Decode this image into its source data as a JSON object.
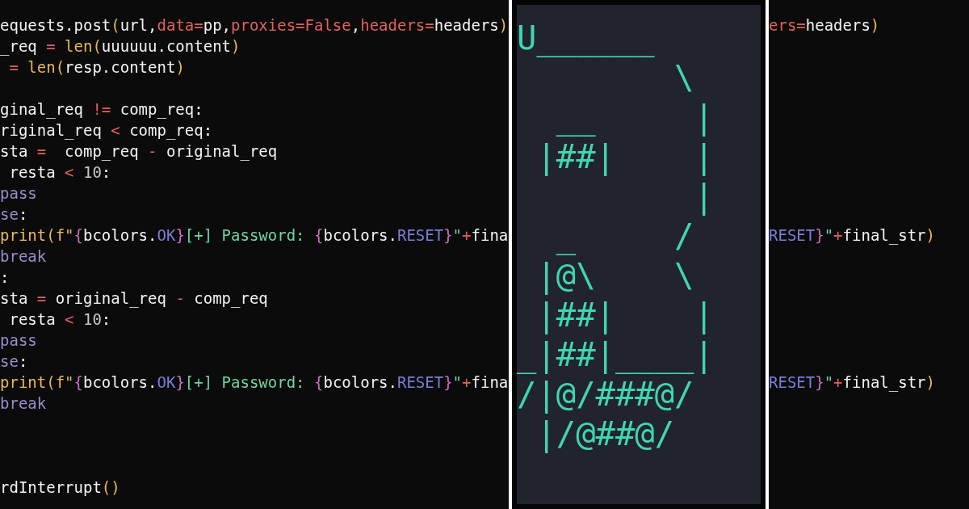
{
  "panels": [
    {
      "kind": "code",
      "lines": [
        {
          "tokens": [
            {
              "text": "equests.post",
              "kind": "plain"
            },
            {
              "text": "(",
              "kind": "call"
            },
            {
              "text": "url,",
              "kind": "plain"
            },
            {
              "text": "data=",
              "kind": "operator"
            },
            {
              "text": "pp,",
              "kind": "plain"
            },
            {
              "text": "proxies=False",
              "kind": "operator"
            },
            {
              "text": ",",
              "kind": "plain"
            },
            {
              "text": "headers=",
              "kind": "operator"
            },
            {
              "text": "headers",
              "kind": "plain"
            },
            {
              "text": ")",
              "kind": "call"
            }
          ]
        },
        {
          "tokens": [
            {
              "text": "_req ",
              "kind": "plain"
            },
            {
              "text": "=",
              "kind": "operator"
            },
            {
              "text": " len(",
              "kind": "call"
            },
            {
              "text": "uuuuuu.content",
              "kind": "plain"
            },
            {
              "text": ")",
              "kind": "call"
            }
          ]
        },
        {
          "tokens": [
            {
              "text": " =",
              "kind": "operator"
            },
            {
              "text": " len(",
              "kind": "call"
            },
            {
              "text": "resp.content",
              "kind": "plain"
            },
            {
              "text": ")",
              "kind": "call"
            }
          ]
        },
        {
          "kind": "blank"
        },
        {
          "tokens": [
            {
              "text": "ginal_req ",
              "kind": "plain"
            },
            {
              "text": "!=",
              "kind": "operator"
            },
            {
              "text": " comp_req:",
              "kind": "plain"
            }
          ]
        },
        {
          "tokens": [
            {
              "text": "riginal_req ",
              "kind": "plain"
            },
            {
              "text": "<",
              "kind": "operator"
            },
            {
              "text": " comp_req:",
              "kind": "plain"
            }
          ]
        },
        {
          "tokens": [
            {
              "text": "sta ",
              "kind": "plain"
            },
            {
              "text": "=",
              "kind": "operator"
            },
            {
              "text": "  comp_req ",
              "kind": "plain"
            },
            {
              "text": "-",
              "kind": "operator"
            },
            {
              "text": " original_req",
              "kind": "plain"
            }
          ]
        },
        {
          "tokens": [
            {
              "text": " resta ",
              "kind": "plain"
            },
            {
              "text": "<",
              "kind": "operator"
            },
            {
              "text": " 10",
              "kind": "number"
            },
            {
              "text": ":",
              "kind": "plain"
            }
          ]
        },
        {
          "tokens": [
            {
              "text": "pass",
              "kind": "keyword"
            }
          ]
        },
        {
          "tokens": [
            {
              "text": "se",
              "kind": "keyword"
            },
            {
              "text": ":",
              "kind": "plain"
            }
          ]
        },
        {
          "tokens": [
            {
              "text": "print(f\"",
              "kind": "call"
            },
            {
              "text": "{",
              "kind": "brace"
            },
            {
              "text": "bcolors.",
              "kind": "plain"
            },
            {
              "text": "OK",
              "kind": "member"
            },
            {
              "text": "}",
              "kind": "brace"
            },
            {
              "text": "[+] Password: ",
              "kind": "string"
            },
            {
              "text": "{",
              "kind": "brace"
            },
            {
              "text": "bcolors.",
              "kind": "plain"
            },
            {
              "text": "RESET",
              "kind": "member"
            },
            {
              "text": "}",
              "kind": "brace"
            },
            {
              "text": "\"",
              "kind": "string"
            },
            {
              "text": "+",
              "kind": "operator"
            },
            {
              "text": "fina",
              "kind": "plain"
            }
          ]
        },
        {
          "tokens": [
            {
              "text": "break",
              "kind": "keyword"
            }
          ]
        },
        {
          "tokens": [
            {
              "text": ":",
              "kind": "plain"
            }
          ]
        },
        {
          "tokens": [
            {
              "text": "sta ",
              "kind": "plain"
            },
            {
              "text": "=",
              "kind": "operator"
            },
            {
              "text": " original_req ",
              "kind": "plain"
            },
            {
              "text": "-",
              "kind": "operator"
            },
            {
              "text": " comp_req",
              "kind": "plain"
            }
          ]
        },
        {
          "tokens": [
            {
              "text": " resta ",
              "kind": "plain"
            },
            {
              "text": "<",
              "kind": "operator"
            },
            {
              "text": " 10",
              "kind": "number"
            },
            {
              "text": ":",
              "kind": "plain"
            }
          ]
        },
        {
          "tokens": [
            {
              "text": "pass",
              "kind": "keyword"
            }
          ]
        },
        {
          "tokens": [
            {
              "text": "se",
              "kind": "keyword"
            },
            {
              "text": ":",
              "kind": "plain"
            }
          ]
        },
        {
          "tokens": [
            {
              "text": "print(f\"",
              "kind": "call"
            },
            {
              "text": "{",
              "kind": "brace"
            },
            {
              "text": "bcolors.",
              "kind": "plain"
            },
            {
              "text": "OK",
              "kind": "member"
            },
            {
              "text": "}",
              "kind": "brace"
            },
            {
              "text": "[+] Password: ",
              "kind": "string"
            },
            {
              "text": "{",
              "kind": "brace"
            },
            {
              "text": "bcolors.",
              "kind": "plain"
            },
            {
              "text": "RESET",
              "kind": "member"
            },
            {
              "text": "}",
              "kind": "brace"
            },
            {
              "text": "\"",
              "kind": "string"
            },
            {
              "text": "+",
              "kind": "operator"
            },
            {
              "text": "fina",
              "kind": "plain"
            }
          ]
        },
        {
          "tokens": [
            {
              "text": "break",
              "kind": "keyword"
            }
          ]
        },
        {
          "kind": "blank"
        },
        {
          "kind": "blank"
        },
        {
          "kind": "blank"
        },
        {
          "tokens": [
            {
              "text": "rdInterrupt",
              "kind": "plain"
            },
            {
              "text": "()",
              "kind": "call"
            }
          ]
        }
      ]
    },
    {
      "kind": "terminal",
      "lines": [
        "U______",
        "        \\",
        "  __     |",
        " |##|    |",
        "         |",
        "  _     /",
        " |@\\    \\",
        " |##|    |",
        "_|##|____|",
        "/|@/###@/",
        " |/@##@/"
      ]
    },
    {
      "kind": "code",
      "lines": [
        {
          "tokens": [
            {
              "text": "ers=",
              "kind": "operator"
            },
            {
              "text": "headers",
              "kind": "plain"
            },
            {
              "text": ")",
              "kind": "call"
            }
          ]
        },
        {
          "kind": "blank"
        },
        {
          "kind": "blank"
        },
        {
          "kind": "blank"
        },
        {
          "kind": "blank"
        },
        {
          "kind": "blank"
        },
        {
          "kind": "blank"
        },
        {
          "kind": "blank"
        },
        {
          "kind": "blank"
        },
        {
          "kind": "blank"
        },
        {
          "tokens": [
            {
              "text": "RESET",
              "kind": "member"
            },
            {
              "text": "}",
              "kind": "brace"
            },
            {
              "text": "\"",
              "kind": "string"
            },
            {
              "text": "+",
              "kind": "operator"
            },
            {
              "text": "final_str",
              "kind": "plain"
            },
            {
              "text": ")",
              "kind": "call"
            }
          ]
        },
        {
          "kind": "blank"
        },
        {
          "kind": "blank"
        },
        {
          "kind": "blank"
        },
        {
          "kind": "blank"
        },
        {
          "kind": "blank"
        },
        {
          "kind": "blank"
        },
        {
          "tokens": [
            {
              "text": "RESET",
              "kind": "member"
            },
            {
              "text": "}",
              "kind": "brace"
            },
            {
              "text": "\"",
              "kind": "string"
            },
            {
              "text": "+",
              "kind": "operator"
            },
            {
              "text": "final_str",
              "kind": "plain"
            },
            {
              "text": ")",
              "kind": "call"
            }
          ]
        }
      ]
    }
  ]
}
